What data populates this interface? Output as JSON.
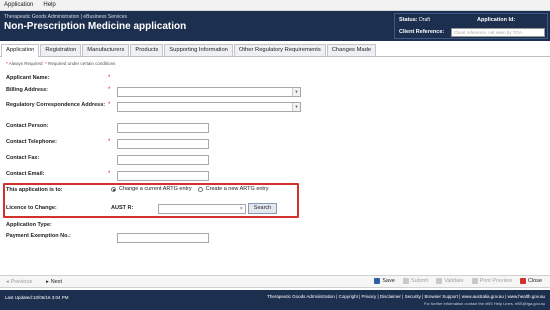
{
  "menu": {
    "items": [
      "Application",
      "Help"
    ]
  },
  "header": {
    "org": "Therapeutic Goods Administration | eBusiness Services",
    "title": "Non-Prescription Medicine application",
    "status_label": "Status:",
    "status_value": "Draft",
    "app_id_label": "Application Id:",
    "client_ref_label": "Client Reference:",
    "client_ref_placeholder": "Client reference, not seen by TGA"
  },
  "tabs": [
    "Application",
    "Registration",
    "Manufacturers",
    "Products",
    "Supporting Information",
    "Other Regulatory Requirements",
    "Changes Made"
  ],
  "legend": {
    "always": "Always Required",
    "conditional": "Required under certain conditions"
  },
  "form": {
    "applicant_name": "Applicant Name:",
    "billing_address": "Billing Address:",
    "regulatory_address": "Regulatory Correspondence Address:",
    "contact_person": "Contact Person:",
    "contact_telephone": "Contact Telephone:",
    "contact_fax": "Contact Fax:",
    "contact_email": "Contact Email:",
    "application_is_to": "This application is to:",
    "option_change": "Change a current ARTG entry",
    "option_create": "Create a new ARTG entry",
    "licence_to_change": "Licence to Change:",
    "aust_r_label": "AUST R:",
    "search_label": "Search",
    "application_type": "Application Type:",
    "payment_exemption": "Payment Exemption No.:"
  },
  "bottom_nav": {
    "previous": "Previous",
    "next": "Next",
    "save": "Save",
    "submit": "Submit",
    "validate": "Validate",
    "print_preview": "Print Preview",
    "close": "Close"
  },
  "footer": {
    "last_updated": "Last Updated:10/06/16 3:04 PM",
    "links": "Therapeutic Goods Administration | Copyright | Privacy | Disclaimer | Security | Browser Support | www.australia.gov.au | www.health.gov.au",
    "support": "For further information contact the eBS Help Lines, eBS@tga.gov.au"
  },
  "colors": {
    "header_bg": "#1c2f4f",
    "highlight_border": "#d2322d",
    "required_star": "#dd1111"
  }
}
